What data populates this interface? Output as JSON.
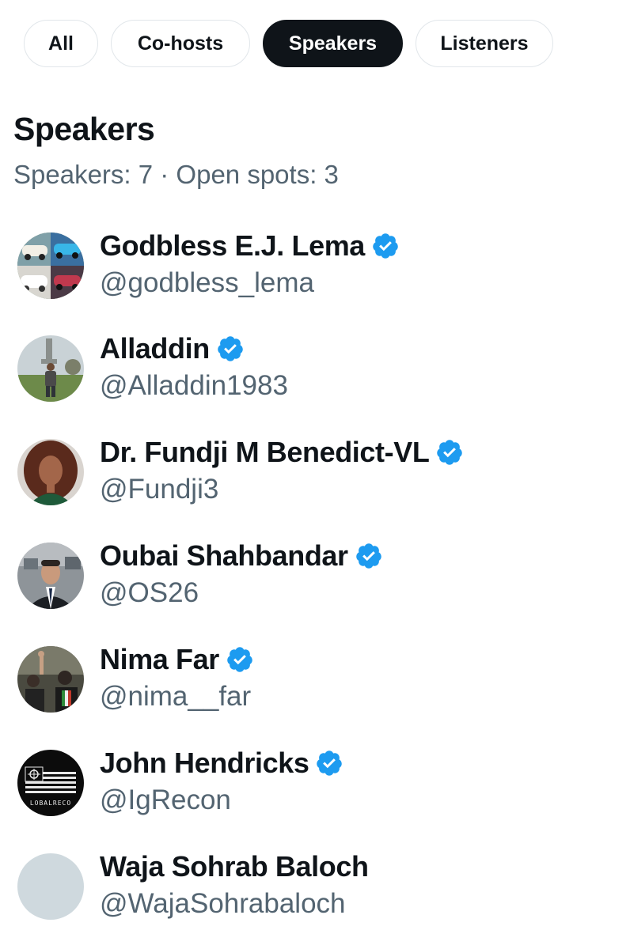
{
  "tabs": [
    {
      "label": "All"
    },
    {
      "label": "Co-hosts"
    },
    {
      "label": "Speakers"
    },
    {
      "label": "Listeners"
    }
  ],
  "active_tab": "Speakers",
  "section": {
    "title": "Speakers",
    "subtitle": "Speakers: 7 · Open spots: 3"
  },
  "speakers": [
    {
      "name": "Godbless E.J. Lema",
      "handle": "@godbless_lema",
      "verified": true,
      "avatar_icon": "vintage-cars-avatar"
    },
    {
      "name": "Alladdin",
      "handle": "@Alladdin1983",
      "verified": true,
      "avatar_icon": "person-outdoors-avatar"
    },
    {
      "name": "Dr. Fundji M Benedict-VL",
      "handle": "@Fundji3",
      "verified": true,
      "avatar_icon": "portrait-avatar"
    },
    {
      "name": "Oubai Shahbandar",
      "handle": "@OS26",
      "verified": true,
      "avatar_icon": "suit-portrait-avatar"
    },
    {
      "name": "Nima Far",
      "handle": "@nima__far",
      "verified": true,
      "avatar_icon": "rally-avatar"
    },
    {
      "name": "John Hendricks",
      "handle": "@IgRecon",
      "verified": true,
      "avatar_icon": "flag-logo-avatar",
      "avatar_text": "LOBALRECO"
    },
    {
      "name": "Waja Sohrab Baloch",
      "handle": "@WajaSohrabaloch",
      "verified": false,
      "avatar_icon": "default-avatar"
    }
  ],
  "colors": {
    "text_primary": "#0f1419",
    "text_secondary": "#536471",
    "verified_blue": "#1d9bf0",
    "tab_active_bg": "#0f1419",
    "tab_border": "#e1e6ea",
    "default_avatar": "#cfd9de"
  }
}
